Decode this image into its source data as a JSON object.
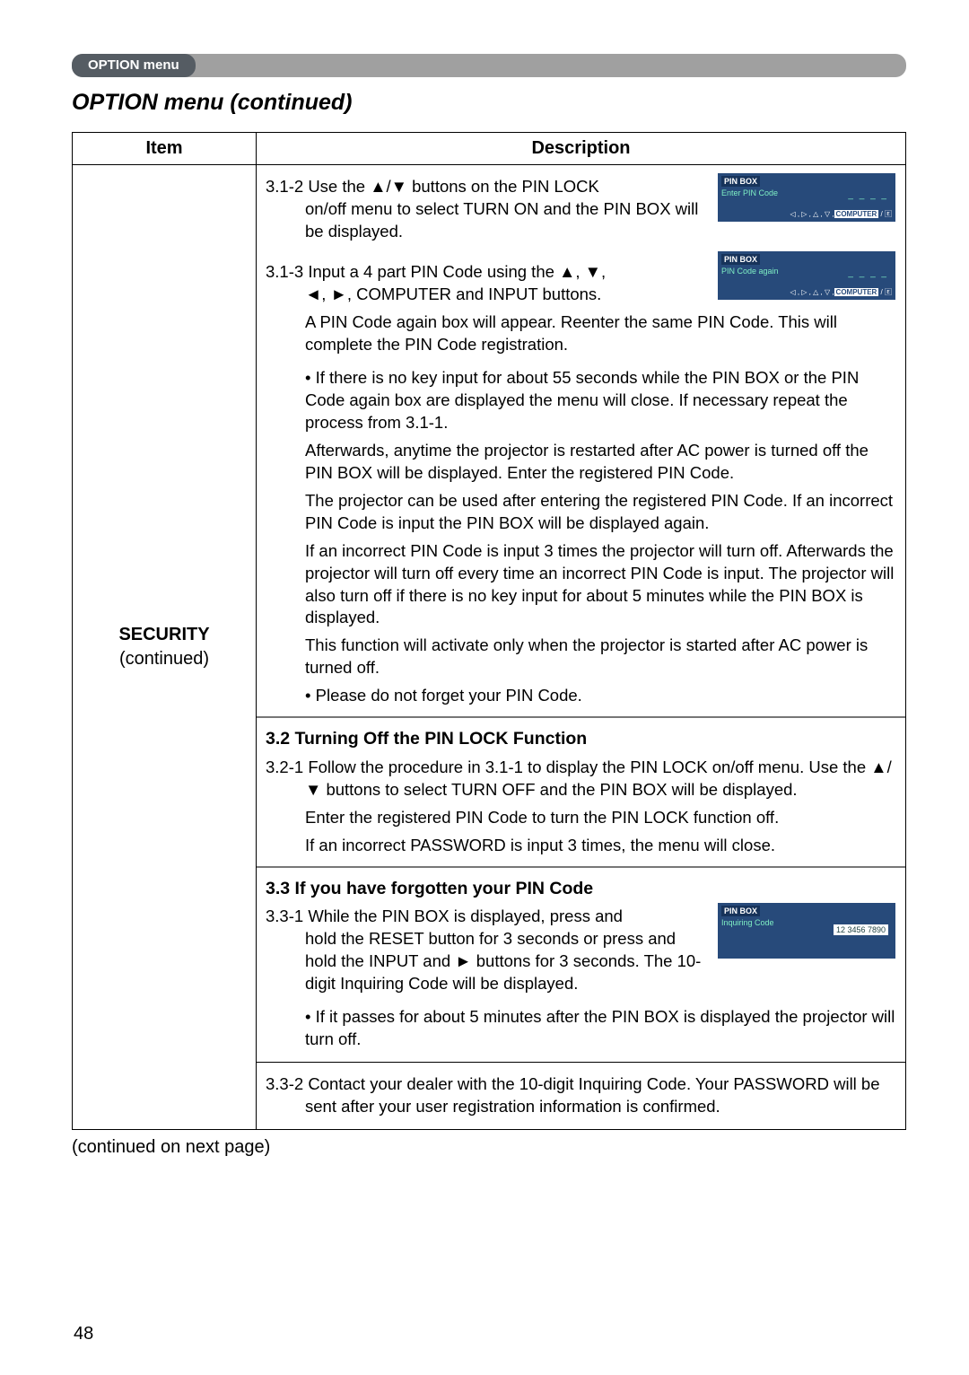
{
  "tab": {
    "label": "OPTION menu"
  },
  "title": "OPTION menu (continued)",
  "table": {
    "headers": {
      "item": "Item",
      "desc": "Description"
    },
    "item": {
      "name": "SECURITY",
      "note": "(continued)"
    },
    "pinboxes": {
      "a": {
        "hdr": "PIN BOX",
        "sub": "Enter PIN Code",
        "dashes": "_ _ _ _",
        "foot_keys": "◁ , ▷ , △ , ▽ ,",
        "foot_hilite": "COMPUTER",
        "foot_tail": " / 🄴"
      },
      "b": {
        "hdr": "PIN BOX",
        "sub": "PIN Code again",
        "dashes": "_ _ _ _",
        "foot_keys": "◁ , ▷ , △ , ▽ ,",
        "foot_hilite": "COMPUTER",
        "foot_tail": " / 🄴"
      },
      "c": {
        "hdr": "PIN BOX",
        "sub": "Inquiring Code",
        "num": "12 3456 7890"
      }
    },
    "s312_lead": "3.1-2 ",
    "s312_l1": "Use the ▲/▼ buttons on the PIN LOCK",
    "s312_l2": "on/off menu to select TURN ON and the PIN BOX will be displayed.",
    "s313_lead": "3.1-3   ",
    "s313_l1": "Input a 4 part PIN Code using the ▲, ▼,",
    "s313_l2": "◄, ►, COMPUTER and INPUT buttons.",
    "s313_l3": "A PIN Code again box will appear. Reenter the same PIN Code. This will complete the PIN Code registration.",
    "s313_bullet": "• If there is no key input for about 55 seconds while the PIN BOX or the PIN Code again box are displayed the menu will close. If necessary repeat the process from 3.1-1.",
    "s313_para1": "Afterwards, anytime the projector is restarted after AC power is turned off the PIN BOX will be displayed. Enter the registered PIN Code.",
    "s313_para2": "The projector can be used after entering the registered PIN Code. If an incorrect PIN Code is input the PIN BOX will be displayed again.",
    "s313_para3": "If an incorrect PIN Code is input 3 times the projector will turn off. Afterwards the projector will turn off every time an incorrect PIN Code is input. The projector will also turn off if there is no key input for about 5 minutes while the PIN BOX is displayed.",
    "s313_para4": "This function will activate only when the projector is started after AC power is turned off.",
    "s313_bullet2": "• Please do not forget your PIN Code.",
    "s32_h": "3.2 Turning Off the PIN LOCK Function",
    "s321_lead": "3.2-1 ",
    "s321_l1": "Follow the procedure in 3.1-1 to display the PIN LOCK on/off menu. Use the ▲/▼ buttons to select TURN OFF and the PIN BOX will be displayed.",
    "s321_l2": "Enter the registered PIN Code to turn the PIN LOCK function off.",
    "s321_l3": "If an incorrect PASSWORD is input 3 times, the menu will close.",
    "s33_h": "3.3 If you have forgotten your PIN Code",
    "s331_lead": "3.3-1 ",
    "s331_l1": "While the PIN BOX is displayed, press and",
    "s331_l2": "hold the RESET button for 3 seconds or press and hold the INPUT and ► buttons for 3 seconds. The 10-digit Inquiring Code will be displayed.",
    "s331_bullet": "• If it passes for about 5 minutes after the PIN BOX is displayed the projector will turn off.",
    "s332_lead": "3.3-2 ",
    "s332_l1": "Contact your dealer with the 10-digit Inquiring Code. Your PASSWORD will be sent after your user registration information is confirmed."
  },
  "continued": "(continued on next page)",
  "pageNumber": "48"
}
